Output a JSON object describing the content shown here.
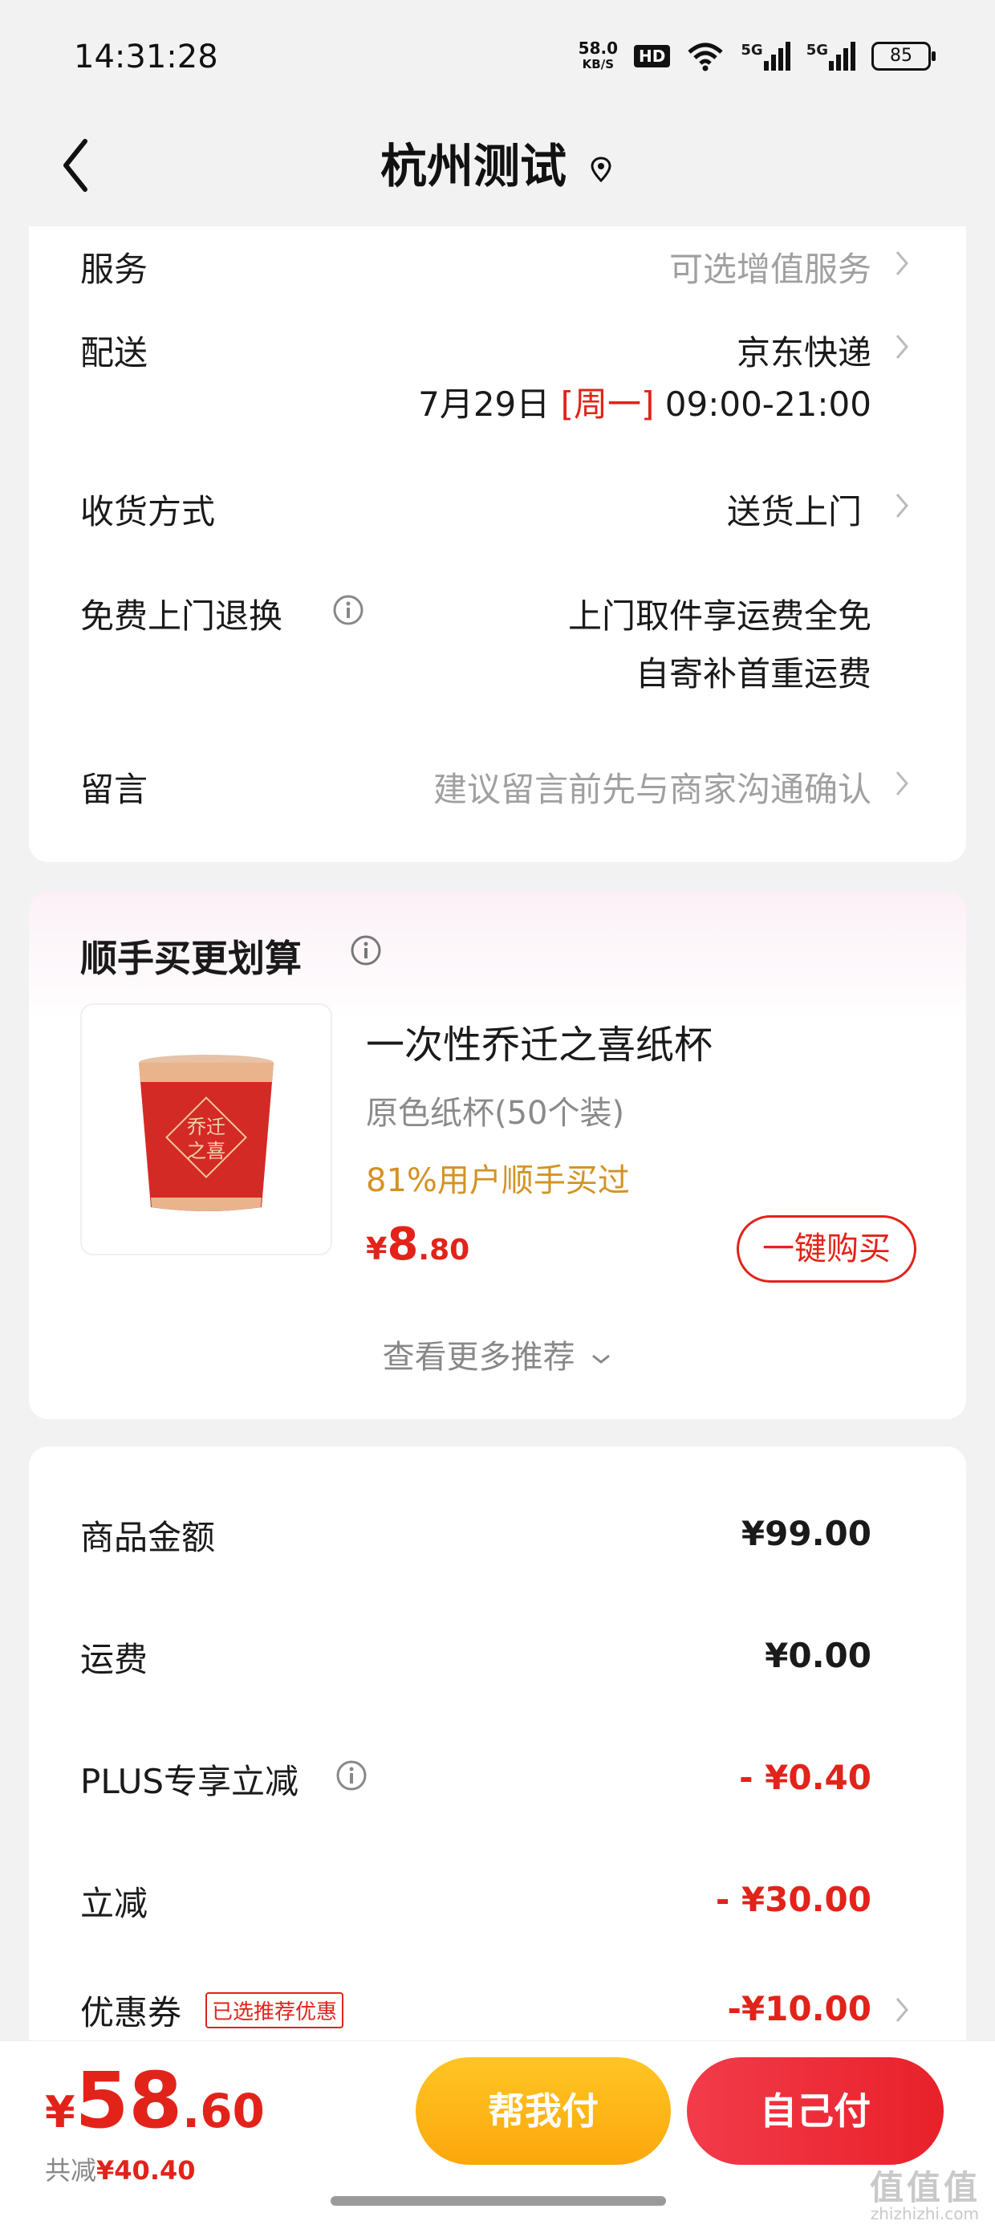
{
  "status_bar": {
    "time": "14:31:28",
    "net_speed_value": "58.0",
    "net_speed_unit": "KB/S",
    "hd_badge": "HD",
    "network_1": "5G",
    "network_2": "5G",
    "battery": "85"
  },
  "header": {
    "title": "杭州测试",
    "back_icon": "chevron-left-icon",
    "location_icon": "location-pin-icon"
  },
  "order_info": {
    "service_label": "服务",
    "service_value": "可选增值服务",
    "delivery_label": "配送",
    "delivery_carrier": "京东快递",
    "delivery_date": "7月29日",
    "delivery_weekday": "[周一]",
    "delivery_time": "09:00-21:00",
    "receive_label": "收货方式",
    "receive_value": "送货上门",
    "return_label": "免费上门退换",
    "return_line1": "上门取件享运费全免",
    "return_line2": "自寄补首重运费",
    "note_label": "留言",
    "note_placeholder": "建议留言前先与商家沟通确认"
  },
  "recommendation": {
    "title": "顺手买更划算",
    "product_name": "一次性乔迁之喜纸杯",
    "product_spec": "原色纸杯(50个装)",
    "product_bought": "81%用户顺手买过",
    "price_currency": "¥",
    "price_int": "8",
    "price_dec": ".80",
    "buy_button": "一键购买",
    "cup_text": "乔迁之喜",
    "more_label": "查看更多推荐"
  },
  "summary": {
    "goods_label": "商品金额",
    "goods_value": "¥99.00",
    "shipping_label": "运费",
    "shipping_value": "¥0.00",
    "plus_label": "PLUS专享立减",
    "plus_value": "- ¥0.40",
    "discount_label": "立减",
    "discount_value": "- ¥30.00",
    "coupon_label": "优惠券",
    "coupon_tag": "已选推荐优惠",
    "coupon_value": "-¥10.00"
  },
  "bottom_bar": {
    "total_currency": "¥",
    "total_int": "58",
    "total_dec": ".60",
    "saved_label": "共减",
    "saved_value": "¥40.40",
    "help_pay_button": "帮我付",
    "self_pay_button": "自己付"
  },
  "watermark": {
    "text": "值值值",
    "sub": "zhizhizhi.com"
  },
  "colors": {
    "accent_red": "#e2231a",
    "bought_orange": "#d49224",
    "help_yellow": "#fdb514",
    "self_red": "#ec2a33",
    "page_bg": "#f2f2f2"
  }
}
